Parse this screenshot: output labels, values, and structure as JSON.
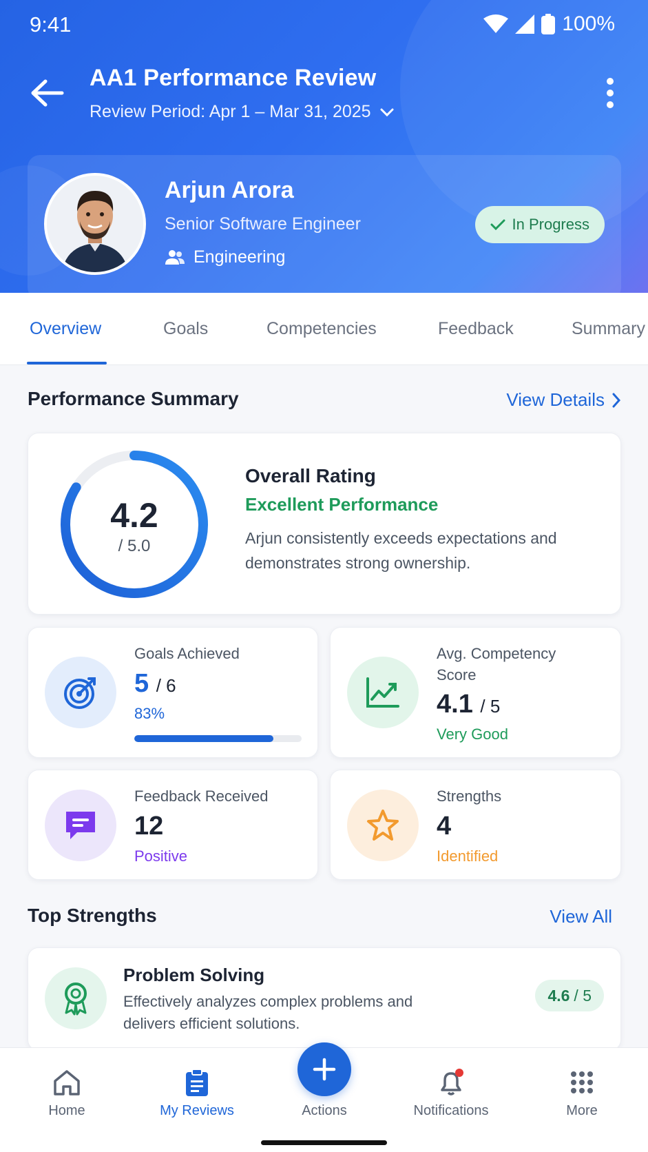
{
  "status_bar": {
    "time": "9:41",
    "battery": "100%"
  },
  "header": {
    "title": "AA1 Performance Review",
    "period": "Review Period: Apr 1 – Mar 31, 2025"
  },
  "profile": {
    "name": "Arjun Arora",
    "role": "Senior Software Engineer",
    "department": "Engineering",
    "status": "In Progress"
  },
  "tabs": [
    "Overview",
    "Goals",
    "Competencies",
    "Feedback",
    "Summary"
  ],
  "performance_summary": {
    "title": "Performance Summary",
    "link": "View Details",
    "rating": "4.2",
    "rating_max": "/ 5.0",
    "rating_fraction": 0.84,
    "rating_title": "Overall Rating",
    "rating_label": "Excellent Performance",
    "rating_desc": "Arjun consistently exceeds expectations and demonstrates strong ownership."
  },
  "stats": {
    "goals": {
      "label": "Goals Achieved",
      "value": "5",
      "of": "/ 6",
      "note": "83%",
      "progress": 0.83
    },
    "competency": {
      "label": "Avg. Competency Score",
      "value": "4.1",
      "of": "/ 5",
      "note": "Very Good"
    },
    "feedback": {
      "label": "Feedback Received",
      "value": "12",
      "note": "Positive"
    },
    "strengths": {
      "label": "Strengths",
      "value": "4",
      "note": "Identified"
    }
  },
  "top_strengths": {
    "title": "Top Strengths",
    "link": "View All",
    "items": [
      {
        "title": "Problem Solving",
        "desc": "Effectively analyzes complex problems and delivers efficient solutions.",
        "score": "4.6",
        "max": "/ 5"
      }
    ]
  },
  "bottom_nav": {
    "home": "Home",
    "reviews": "My Reviews",
    "actions": "Actions",
    "notifications": "Notifications",
    "more": "More"
  },
  "colors": {
    "primary": "#1f66d8",
    "success": "#1e9b5a",
    "purple": "#7c3aed",
    "orange": "#f29a2e"
  }
}
